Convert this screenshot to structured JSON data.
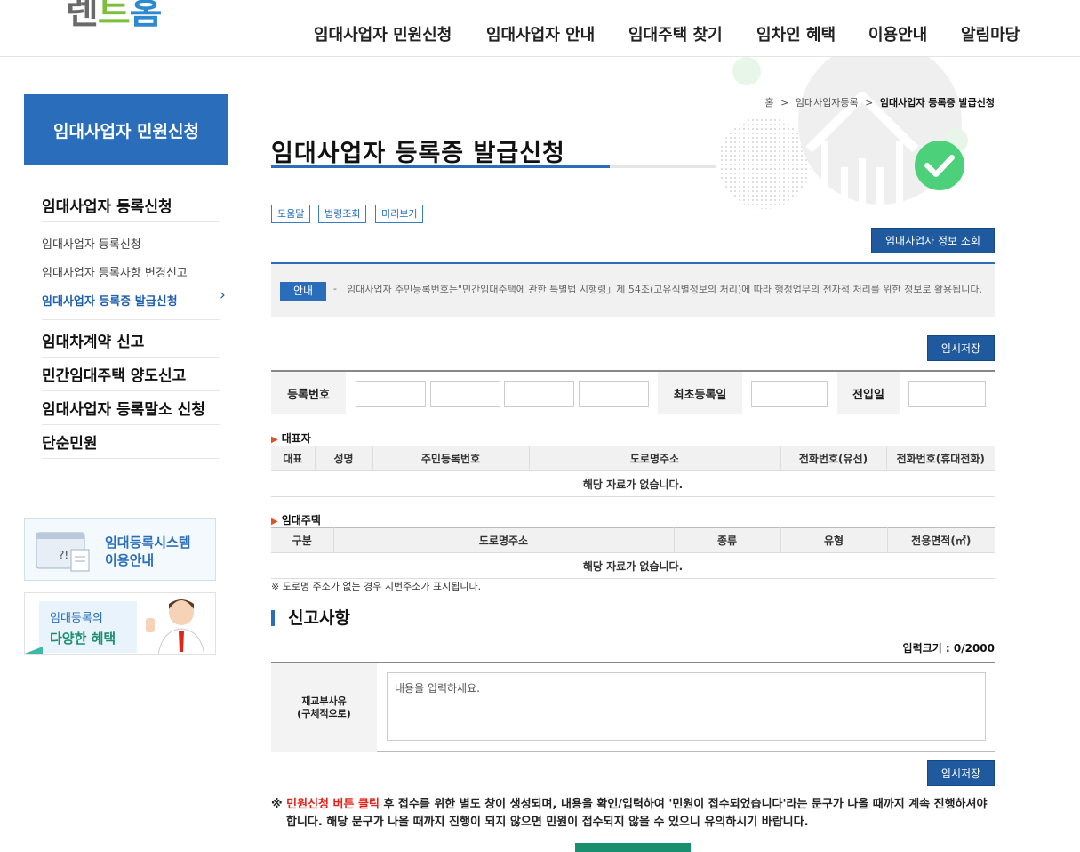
{
  "header": {
    "logo_text_1": "렌",
    "logo_text_2": "트",
    "logo_text_3": "홈",
    "nav": [
      "임대사업자 민원신청",
      "임대사업자 안내",
      "임대주택 찾기",
      "임차인 혜택",
      "이용안내",
      "알림마당"
    ]
  },
  "sidebar": {
    "title": "임대사업자 민원신청",
    "groups": [
      {
        "label": "임대사업자 등록신청",
        "items": [
          "임대사업자 등록신청",
          "임대사업자 등록사항 변경신고",
          "임대사업자 등록증 발급신청"
        ]
      },
      {
        "label": "임대차계약 신고"
      },
      {
        "label": "민간임대주택 양도신고"
      },
      {
        "label": "임대사업자 등록말소 신청"
      },
      {
        "label": "단순민원"
      }
    ],
    "active_item_arrow": "›",
    "banner1": {
      "line1": "임대등록시스템",
      "line2": "이용안내"
    },
    "banner2": {
      "line1": "임대등록의",
      "line2": "다양한 혜택"
    }
  },
  "breadcrumb": {
    "home": "홈",
    "sep": ">",
    "level1": "임대사업자등록",
    "current": "임대사업자 등록증 발급신청"
  },
  "page": {
    "title": "임대사업자 등록증 발급신청",
    "tool_buttons": [
      "도움말",
      "법령조회",
      "미리보기"
    ],
    "info_lookup_button": "임대사업자 정보 조회",
    "guide": {
      "tag": "안내",
      "dash": "-",
      "text": "임대사업자 주민등록번호는\"민간임대주택에 관한 특별법 시행령」제 54조(고유식별정보의 처리)에 따라 행정업무의 전자적 처리를 위한 정보로 활용됩니다."
    },
    "temp_save": "임시저장",
    "reg_form": {
      "reg_no_label": "등록번호",
      "first_reg_label": "최초등록일",
      "move_in_label": "전입일"
    },
    "rep_section": {
      "title": "대표자",
      "headers": [
        "대표",
        "성명",
        "주민등록번호",
        "도로명주소",
        "전화번호(유선)",
        "전화번호(휴대전화)"
      ],
      "empty": "해당 자료가 없습니다."
    },
    "house_section": {
      "title": "임대주택",
      "headers": [
        "구분",
        "도로명주소",
        "종류",
        "유형",
        "전용면적(㎡)"
      ],
      "empty": "해당 자료가 없습니다.",
      "note": "※ 도로명 주소가 없는 경우 지번주소가 표시됩니다."
    },
    "report": {
      "heading": "신고사항",
      "count": "입력크기 : 0/2000",
      "label_line1": "재교부사유",
      "label_line2": "(구체적으로)",
      "placeholder": "내용을 입력하세요."
    },
    "warning": {
      "mark": "※",
      "red": "민원신청 버튼 클릭",
      "rest": " 후 접수를 위한 별도 창이 생성되며, 내용을 확인/입력하여 '민원이 접수되었습니다'라는 문구가 나올 때까지 계속 진행하셔야 합니다. 해당 문구가 나올 때까지 진행이 되지 않으면 민원이 접수되지 않을 수 있으니 유의하시기 바랍니다."
    }
  },
  "colors": {
    "primary": "#2a6ebb",
    "button": "#1f5a9e",
    "warning_red": "#e2231a",
    "deco_green": "#4cd17a"
  }
}
